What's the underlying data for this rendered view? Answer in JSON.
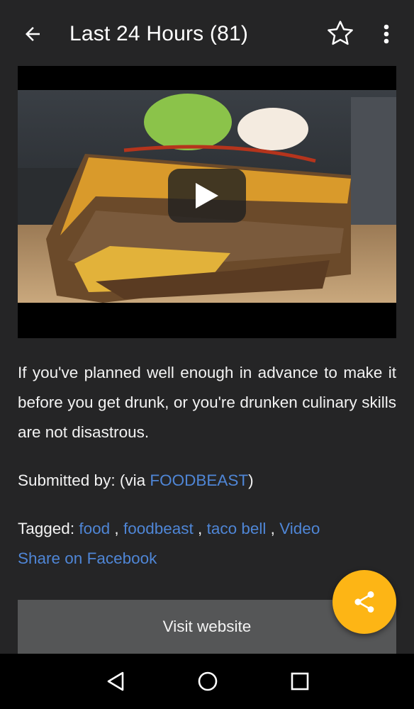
{
  "app_bar": {
    "title": "Last 24 Hours (81)",
    "back_icon": "arrow-back-icon",
    "favorite_icon": "star-outline-icon",
    "menu_icon": "more-vert-icon"
  },
  "video": {
    "play_icon": "play-icon"
  },
  "post": {
    "description": "If you've planned well enough in advance to make it before you get drunk, or you're drunken culinary skills are not disastrous.",
    "submitted_prefix": "Submitted by: (via ",
    "submitted_source": "FOODBEAST",
    "submitted_suffix": ")",
    "tagged_label": "Tagged:",
    "tags": [
      "food",
      "foodbeast",
      "taco bell",
      "Video"
    ],
    "tag_separator": ",",
    "share_facebook": "Share on Facebook",
    "visit_button": "Visit website"
  },
  "fab": {
    "icon": "share-icon",
    "color": "#fdb515"
  },
  "nav": {
    "back_icon": "nav-back-icon",
    "home_icon": "nav-home-icon",
    "recents_icon": "nav-recents-icon"
  },
  "colors": {
    "background": "#252526",
    "link": "#4f86d6",
    "button": "#555657"
  }
}
